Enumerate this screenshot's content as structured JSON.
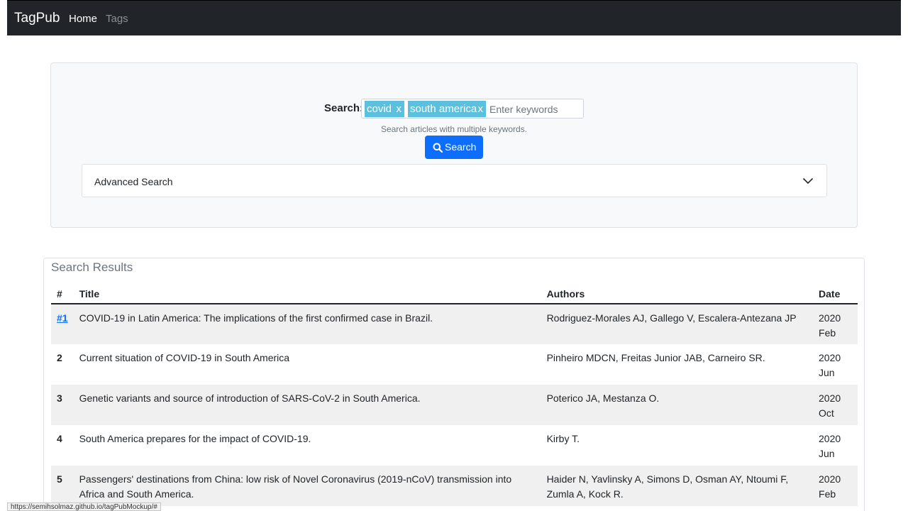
{
  "navbar": {
    "brand": "TagPub",
    "links": [
      {
        "label": "Home",
        "active": true
      },
      {
        "label": "Tags",
        "active": false
      }
    ]
  },
  "search": {
    "label": "Search:",
    "tags": [
      {
        "text": "covid",
        "remove": "x"
      },
      {
        "text": "south america",
        "remove": "x"
      }
    ],
    "placeholder": "Enter keywords",
    "help_text": "Search articles with multiple keywords.",
    "button_label": "Search",
    "advanced_label": "Advanced Search"
  },
  "results": {
    "title": "Search Results",
    "headers": [
      "#",
      "Title",
      "Authors",
      "Date"
    ],
    "rows": [
      {
        "num": "#1",
        "title": "COVID-19 in Latin America: The implications of the first confirmed case in Brazil.",
        "authors": "Rodriguez-Morales AJ, Gallego V, Escalera-Antezana JP",
        "year": "2020",
        "month": "Feb"
      },
      {
        "num": "2",
        "title": "Current situation of COVID-19 in South America",
        "authors": "Pinheiro MDCN, Freitas Junior JAB, Carneiro SR.",
        "year": "2020",
        "month": "Jun"
      },
      {
        "num": "3",
        "title": "Genetic variants and source of introduction of SARS-CoV-2 in South America.",
        "authors": "Poterico JA, Mestanza O.",
        "year": "2020",
        "month": "Oct"
      },
      {
        "num": "4",
        "title": "South America prepares for the impact of COVID-19.",
        "authors": "Kirby T.",
        "year": "2020",
        "month": "Jun"
      },
      {
        "num": "5",
        "title": "Passengers' destinations from China: low risk of Novel Coronavirus (2019-nCoV) transmission into Africa and South America.",
        "authors": "Haider N, Yavlinsky A, Simons D, Osman AY, Ntoumi F, Zumla A, Kock R.",
        "year": "2020",
        "month": "Feb"
      }
    ]
  },
  "status_url": "https://semihsolmaz.github.io/tagPubMockup/#",
  "colors": {
    "navbar_bg": "#212529",
    "tag_bg": "#5bc0de",
    "primary": "#0d6efd"
  },
  "icons": {
    "search_button": "search-icon",
    "accordion": "chevron-down-icon"
  }
}
